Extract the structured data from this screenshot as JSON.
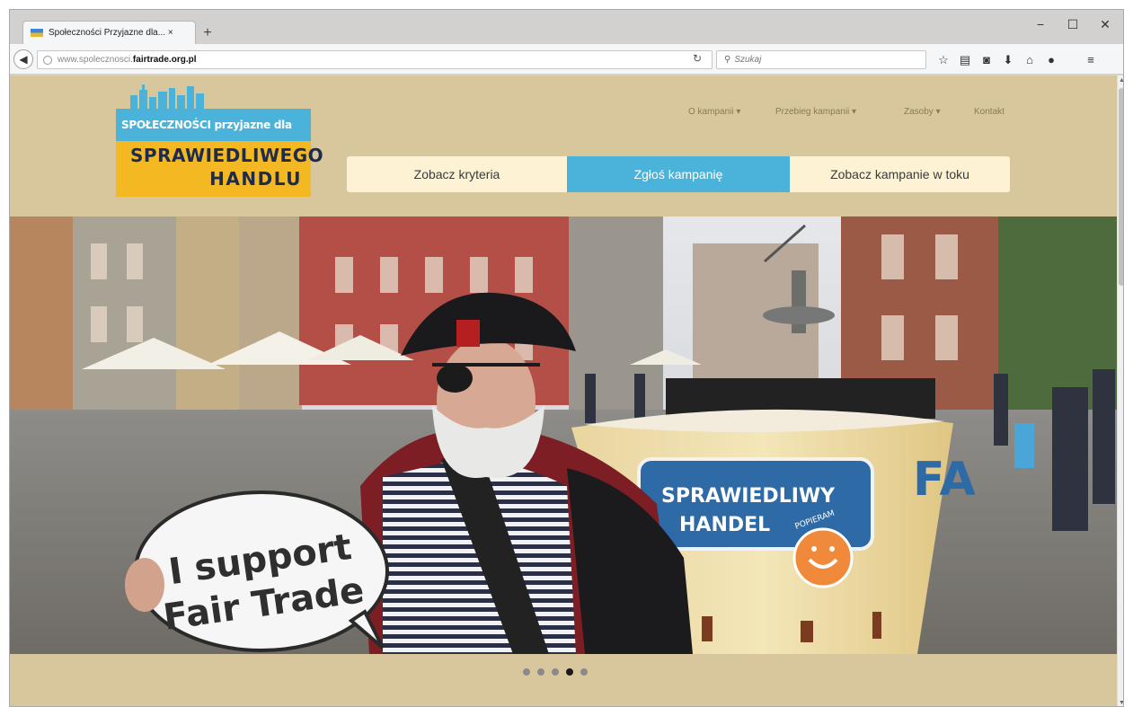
{
  "browser": {
    "tab_title": "Społeczności Przyjazne dla... ×",
    "new_tab": "+",
    "url_prefix": "www.spolecznosci.",
    "url_host": "fairtrade.org.pl",
    "search_placeholder": "Szukaj",
    "window_controls": [
      "−",
      "☐",
      "✕"
    ]
  },
  "logo": {
    "top_line": "SPOŁECZNOŚCI przyjazne dla",
    "line1": "SPRAWIEDLIWEGO",
    "line2": "HANDLU"
  },
  "menu": {
    "items": [
      "O kampanii ▾",
      "Przebieg kampanii ▾",
      "Zasoby ▾",
      "Kontakt"
    ]
  },
  "buttons": {
    "criteria": "Zobacz kryteria",
    "report": "Zgłoś kampanię",
    "campaigns": "Zobacz kampanie w toku"
  },
  "hero": {
    "sign_line1": "I support",
    "sign_line2": "Fair Trade",
    "cup_line1": "SPRAWIEDLIWY",
    "cup_line2": "HANDEL",
    "cup_badge": "POPIERAM",
    "cup_big": "FA"
  },
  "carousel": {
    "count": 5,
    "active_index": 3
  },
  "colors": {
    "page_bg": "#d8c79c",
    "accent_blue": "#4bb3d9",
    "button_cream": "#fdf3d4",
    "logo_yellow": "#f4b823"
  }
}
